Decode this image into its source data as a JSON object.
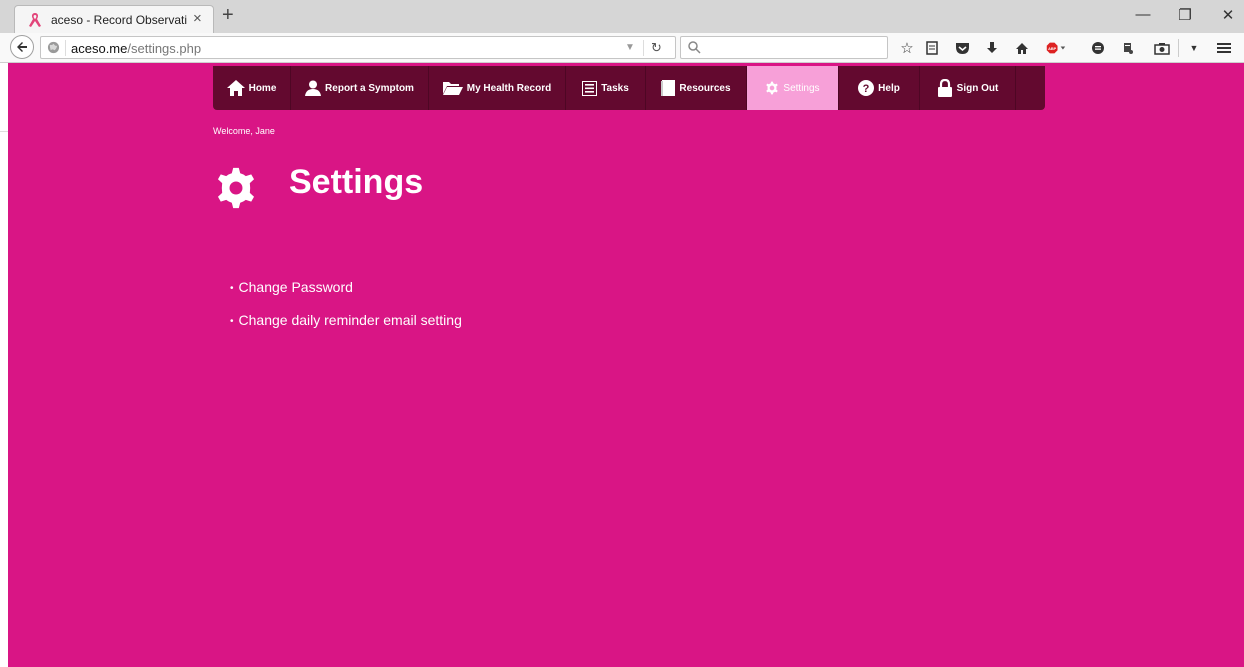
{
  "browser": {
    "tab_title": "aceso - Record Observatio...",
    "tab_close": "×",
    "new_tab": "+",
    "url_host": "aceso.me",
    "url_path": "/settings.php",
    "window_controls": {
      "minimize": "—",
      "restore": "❐",
      "close": "✕"
    },
    "toolbar_icons": [
      "bookmark-star-icon",
      "reading-list-icon",
      "pocket-icon",
      "download-icon",
      "home-icon",
      "adblock-icon",
      "chat-icon",
      "extension-icon",
      "screenshot-icon",
      "menu-icon"
    ]
  },
  "nav": {
    "home": "Home",
    "report": "Report a Symptom",
    "record": "My Health Record",
    "tasks": "Tasks",
    "resources": "Resources",
    "settings": "Settings",
    "help": "Help",
    "signout": "Sign Out"
  },
  "welcome": "Welcome, Jane",
  "page_title": "Settings",
  "settings_links": [
    {
      "label": "Change Password"
    },
    {
      "label": "Change daily reminder email setting"
    }
  ],
  "colors": {
    "background": "#d91585",
    "menu_bar": "#63092f",
    "menu_active": "#f7a0d8",
    "text": "#ffffff"
  }
}
